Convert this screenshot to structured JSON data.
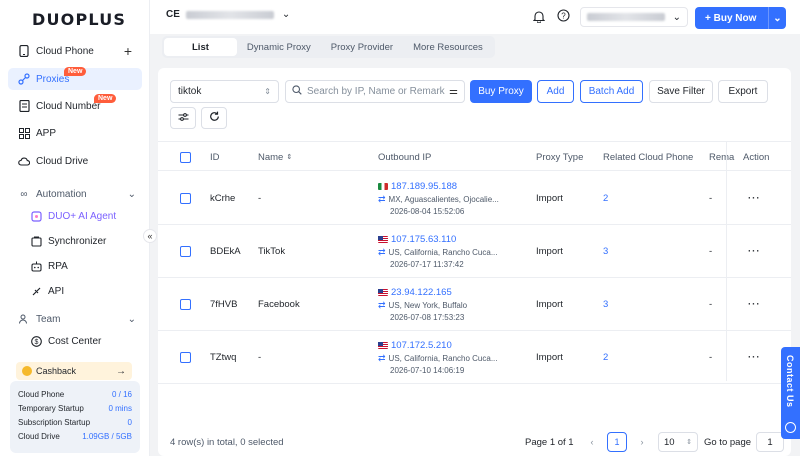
{
  "app": {
    "logo": "DUOPLUS"
  },
  "sidebar": {
    "items": [
      {
        "label": "Cloud Phone"
      },
      {
        "label": "Proxies",
        "badge": "New"
      },
      {
        "label": "Cloud Number",
        "badge": "New"
      },
      {
        "label": "APP"
      },
      {
        "label": "Cloud Drive"
      }
    ],
    "automation": {
      "label": "Automation",
      "items": [
        {
          "label": "DUO+ AI Agent"
        },
        {
          "label": "Synchronizer"
        },
        {
          "label": "RPA"
        },
        {
          "label": "API"
        }
      ]
    },
    "team": {
      "label": "Team",
      "items": [
        {
          "label": "Cost Center"
        }
      ]
    },
    "cashback": {
      "label": "Cashback"
    },
    "stats": [
      {
        "label": "Cloud Phone",
        "value": "0 / 16"
      },
      {
        "label": "Temporary Startup",
        "value": "0 mins"
      },
      {
        "label": "Subscription Startup",
        "value": "0"
      },
      {
        "label": "Cloud Drive",
        "value": "1.09GB / 5GB"
      }
    ]
  },
  "topbar": {
    "team_initials": "CE",
    "buy_now_label": "+ Buy Now"
  },
  "tabs": [
    {
      "label": "List",
      "active": true
    },
    {
      "label": "Dynamic Proxy"
    },
    {
      "label": "Proxy Provider"
    },
    {
      "label": "More Resources"
    }
  ],
  "toolbar": {
    "type_select_value": "tiktok",
    "search_placeholder": "Search by IP, Name or Remark",
    "buy_proxy_label": "Buy Proxy",
    "add_label": "Add",
    "batch_add_label": "Batch Add",
    "save_filter_label": "Save Filter",
    "export_label": "Export"
  },
  "table": {
    "columns": [
      "ID",
      "Name",
      "Outbound IP",
      "Proxy Type",
      "Related Cloud Phone",
      "Rema",
      "Action"
    ],
    "rows": [
      {
        "id": "kCrhe",
        "name": "-",
        "flag": "mx",
        "ip": "187.189.95.188",
        "location": "MX, Aguascalientes, Ojocalie...",
        "time": "2026-08-04 15:52:06",
        "type": "Import",
        "related": "2",
        "remark": "-"
      },
      {
        "id": "BDEkA",
        "name": "TikTok",
        "flag": "us",
        "ip": "107.175.63.110",
        "location": "US, California, Rancho Cuca...",
        "time": "2026-07-17 11:37:42",
        "type": "Import",
        "related": "3",
        "remark": "-"
      },
      {
        "id": "7fHVB",
        "name": "Facebook",
        "flag": "us",
        "ip": "23.94.122.165",
        "location": "US, New York, Buffalo",
        "time": "2026-07-08 17:53:23",
        "type": "Import",
        "related": "3",
        "remark": "-"
      },
      {
        "id": "TZtwq",
        "name": "-",
        "flag": "us",
        "ip": "107.172.5.210",
        "location": "US, California, Rancho Cuca...",
        "time": "2026-07-10 14:06:19",
        "type": "Import",
        "related": "2",
        "remark": "-"
      }
    ]
  },
  "footer": {
    "summary": "4 row(s) in total, 0 selected",
    "page_label": "Page 1 of 1",
    "current_page": "1",
    "page_size": "10",
    "goto_label": "Go to page",
    "goto_value": "1"
  },
  "contact": {
    "label": "Contact Us"
  },
  "colors": {
    "accent": "#3370ff",
    "badge": "#ff5d3b"
  }
}
